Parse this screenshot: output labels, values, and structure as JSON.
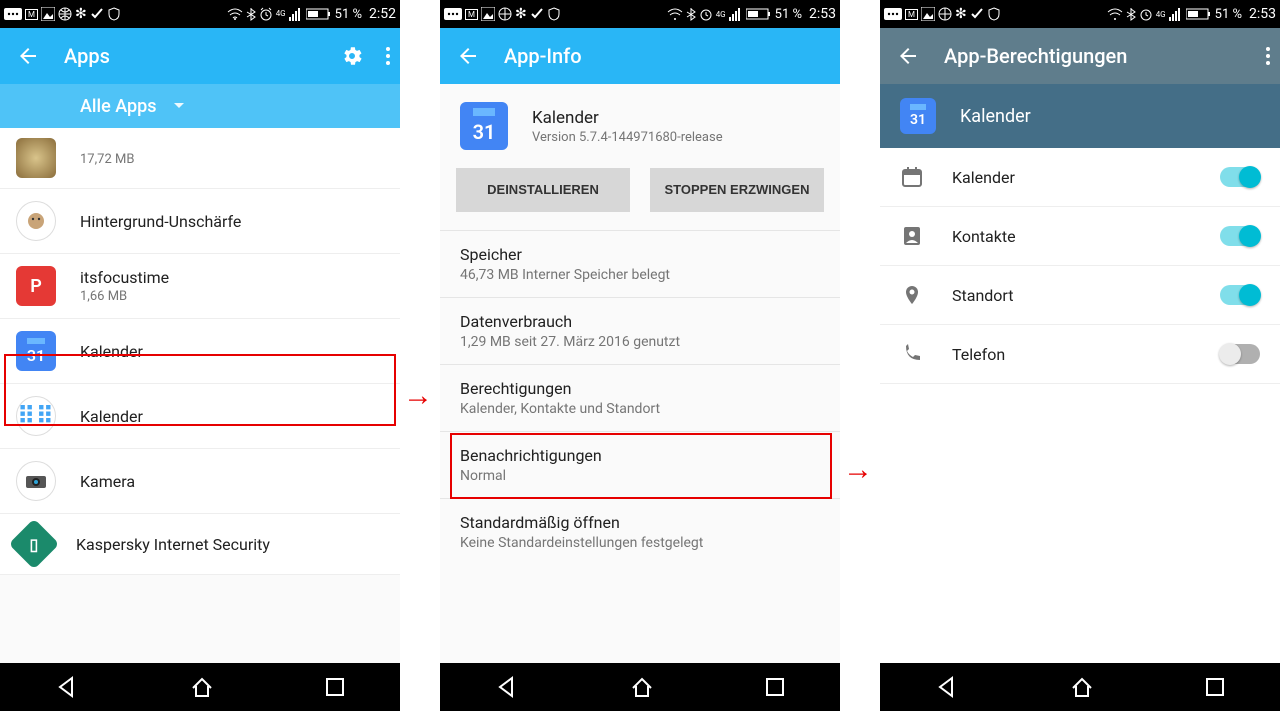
{
  "status": {
    "battery": "51 %",
    "time1": "2:52",
    "time2": "2:53",
    "time3": "2:53"
  },
  "screen1": {
    "title": "Apps",
    "spinner": "Alle Apps",
    "rows": [
      {
        "name": "",
        "sub": "17,72 MB",
        "icon": "hearth"
      },
      {
        "name": "Hintergrund-Unschärfe",
        "sub": "",
        "icon": "blur"
      },
      {
        "name": "itsfocustime",
        "sub": "1,66 MB",
        "icon": "focus"
      },
      {
        "name": "Kalender",
        "sub": "",
        "icon": "cal"
      },
      {
        "name": "Kalender",
        "sub": "",
        "icon": "kal2"
      },
      {
        "name": "Kamera",
        "sub": "",
        "icon": "cam"
      },
      {
        "name": "Kaspersky Internet Security",
        "sub": "",
        "icon": "kasper"
      }
    ],
    "cal_label": "31"
  },
  "screen2": {
    "title": "App-Info",
    "appname": "Kalender",
    "version": "Version 5.7.4-144971680-release",
    "btn_uninstall": "DEINSTALLIEREN",
    "btn_forcestop": "STOPPEN ERZWINGEN",
    "sections": [
      {
        "title": "Speicher",
        "sub": "46,73 MB Interner Speicher belegt"
      },
      {
        "title": "Datenverbrauch",
        "sub": "1,29 MB seit 27. März 2016 genutzt"
      },
      {
        "title": "Berechtigungen",
        "sub": "Kalender, Kontakte und Standort"
      },
      {
        "title": "Benachrichtigungen",
        "sub": "Normal"
      },
      {
        "title": "Standardmäßig öffnen",
        "sub": "Keine Standardeinstellungen festgelegt"
      }
    ]
  },
  "screen3": {
    "title": "App-Berechtigungen",
    "appname": "Kalender",
    "perms": [
      {
        "label": "Kalender",
        "on": true,
        "icon": "cal"
      },
      {
        "label": "Kontakte",
        "on": true,
        "icon": "contacts"
      },
      {
        "label": "Standort",
        "on": true,
        "icon": "location"
      },
      {
        "label": "Telefon",
        "on": false,
        "icon": "phone"
      }
    ]
  }
}
